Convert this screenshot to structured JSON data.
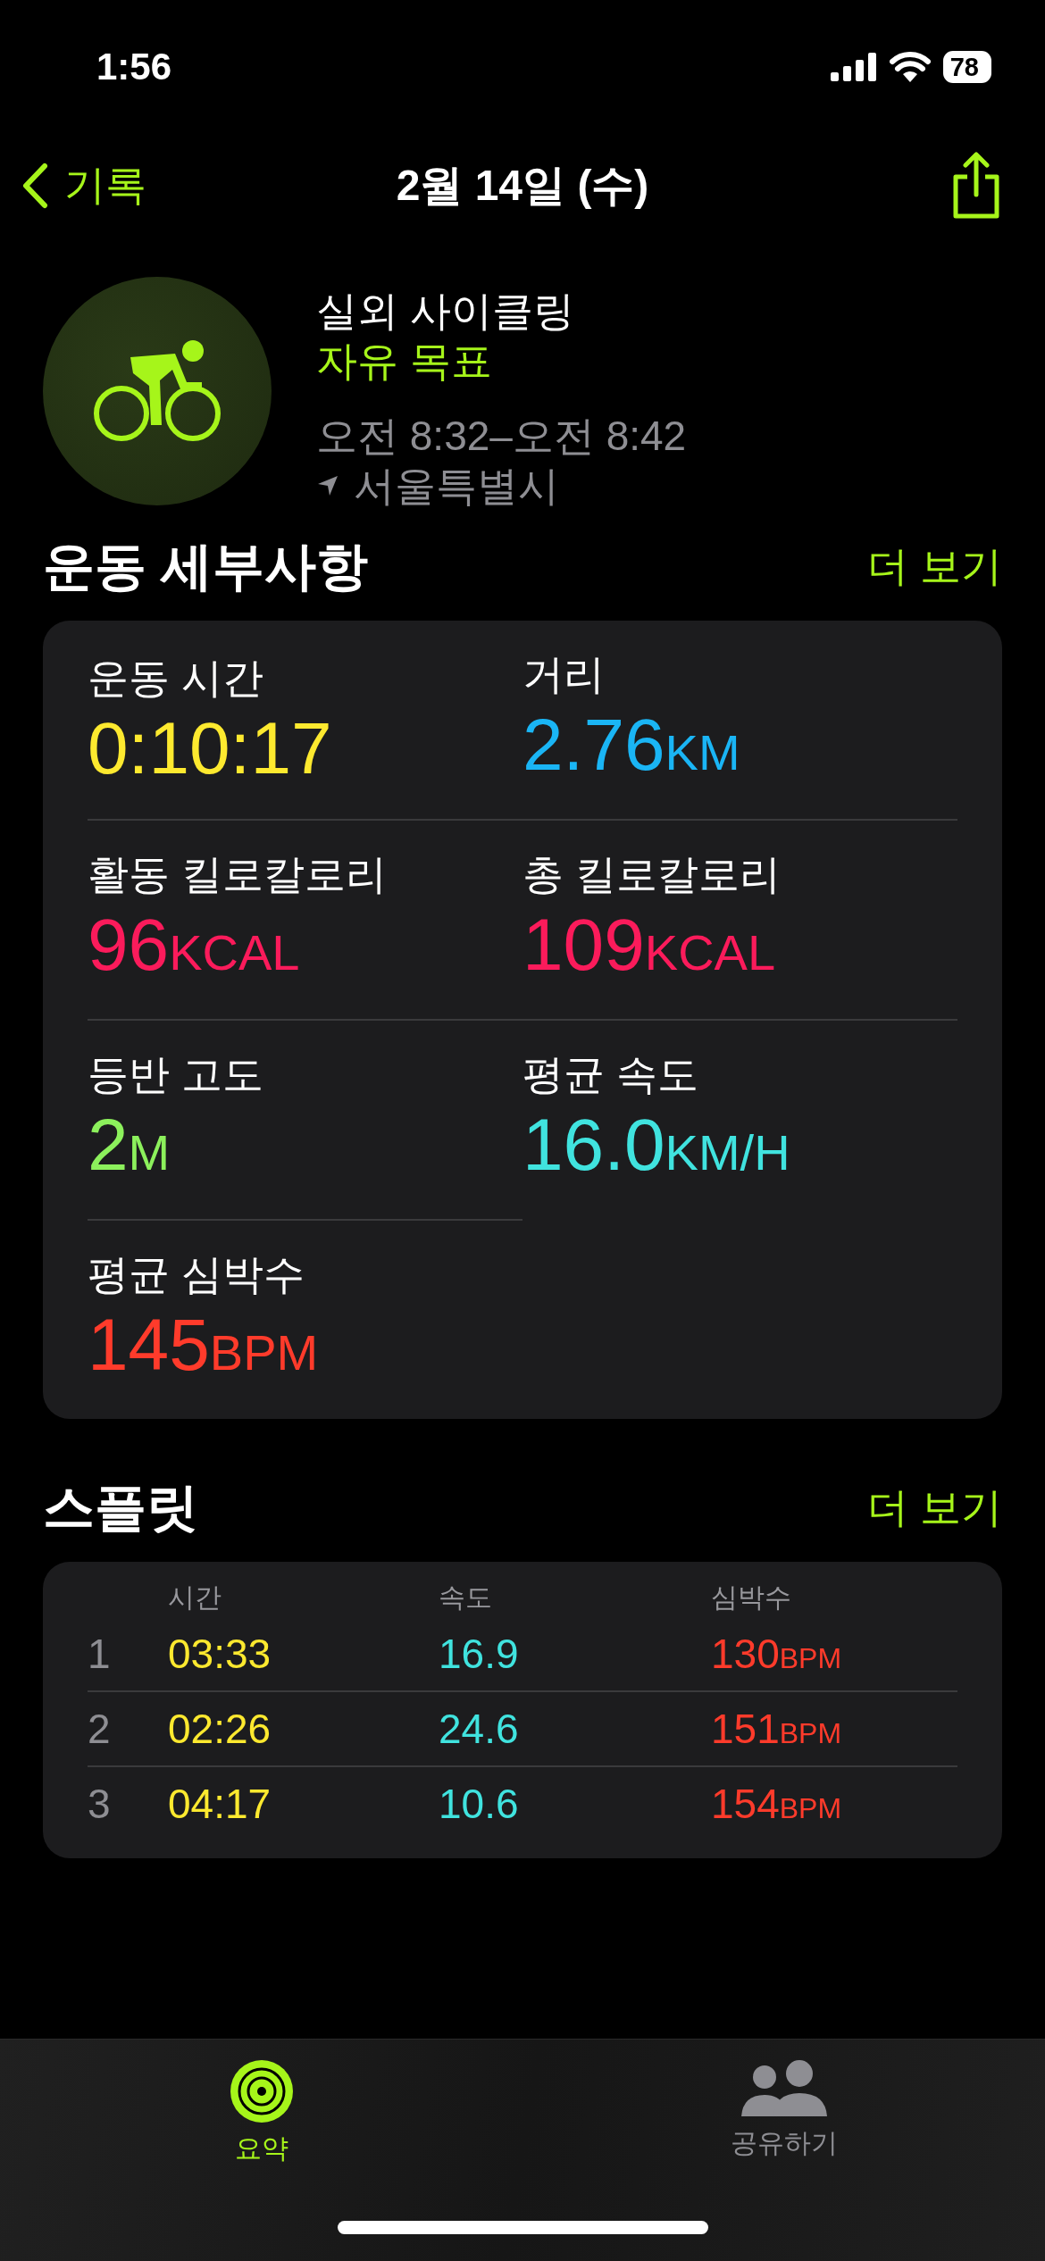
{
  "status_bar": {
    "time": "1:56",
    "battery": "78"
  },
  "nav": {
    "back": "기록",
    "title": "2월 14일 (수)"
  },
  "workout": {
    "title": "실외 사이클링",
    "goal": "자유 목표",
    "time_range": "오전 8:32–오전 8:42",
    "location": "서울특별시"
  },
  "details": {
    "title": "운동 세부사항",
    "more": "더 보기",
    "metrics": [
      {
        "label": "운동 시간",
        "value": "0:10:17",
        "color": "#fde92f"
      },
      {
        "label": "거리",
        "value": "2.76",
        "unit": "KM",
        "color": "#1ab5f5"
      },
      {
        "label": "활동 킬로칼로리",
        "value": "96",
        "unit": "KCAL",
        "color": "#fb1b5b"
      },
      {
        "label": "총 킬로칼로리",
        "value": "109",
        "unit": "KCAL",
        "color": "#fb1b5b"
      },
      {
        "label": "등반 고도",
        "value": "2",
        "unit": "M",
        "color": "#8cf05c"
      },
      {
        "label": "평균 속도",
        "value": "16.0",
        "unit": "KM/H",
        "color": "#40e3df"
      },
      {
        "label": "평균 심박수",
        "value": "145",
        "unit": "BPM",
        "color": "#ff3b2b"
      }
    ]
  },
  "splits": {
    "title": "스플릿",
    "more": "더 보기",
    "columns": [
      "시간",
      "속도",
      "심박수"
    ],
    "rows": [
      {
        "index": "1",
        "time": "03:33",
        "speed": "16.9",
        "heart_rate": "130",
        "heart_rate_unit": "BPM"
      },
      {
        "index": "2",
        "time": "02:26",
        "speed": "24.6",
        "heart_rate": "151",
        "heart_rate_unit": "BPM"
      },
      {
        "index": "3",
        "time": "04:17",
        "speed": "10.6",
        "heart_rate": "154",
        "heart_rate_unit": "BPM"
      }
    ]
  },
  "tab_bar": [
    {
      "label": "요약",
      "selected": true
    },
    {
      "label": "공유하기",
      "selected": false
    }
  ]
}
